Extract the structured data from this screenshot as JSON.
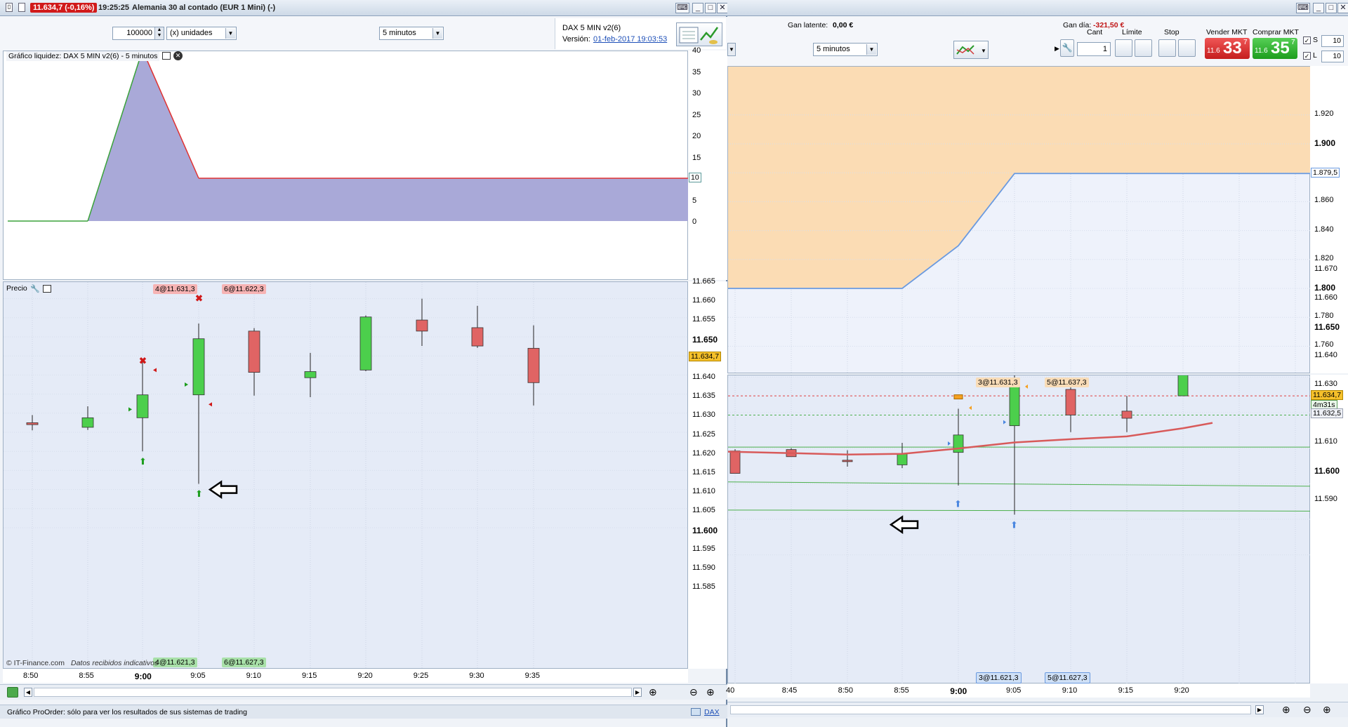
{
  "left_window": {
    "price": "11.634,7 (-0,16%)",
    "time": "19:25:25",
    "instrument": "Alemania 30 al contado (EUR 1 Mini) (-)",
    "quantity_value": "100000",
    "units_select": "(x) unidades",
    "timeframe_select": "5 minutos",
    "strategy_name": "DAX 5 MIN v2(6)",
    "version_label": "Versión:",
    "version_date": "01-feb-2017 19:03:53",
    "equity_panel_title": "Gráfico liquidez: DAX 5 MIN v2(6) - 5 minutos",
    "equity_axis": [
      "40",
      "35",
      "30",
      "25",
      "20",
      "15",
      "10",
      "5",
      "0"
    ],
    "equity_current_marker": "10",
    "price_panel_title": "Precio",
    "price_axis": [
      "11.665",
      "11.660",
      "11.655",
      "11.650",
      "11.645",
      "11.640",
      "11.635",
      "11.630",
      "11.625",
      "11.620",
      "11.615",
      "11.610",
      "11.605",
      "11.600",
      "11.595",
      "11.590",
      "11.585"
    ],
    "price_bold_ticks": [
      "11.650",
      "11.600"
    ],
    "current_price_marker": "11.634,7",
    "order_tags_top": [
      "4@11.631,3",
      "6@11.622,3"
    ],
    "order_tags_bottom": [
      "4@11.621,3",
      "6@11.627,3"
    ],
    "watermark_source": "© IT-Finance.com",
    "watermark_note": "Datos recibidos indicativos",
    "time_axis": [
      "8:50",
      "8:55",
      "9:00",
      "9:05",
      "9:10",
      "9:15",
      "9:20",
      "9:25",
      "9:30",
      "9:35"
    ],
    "status_bar": "Gráfico ProOrder: sólo para ver los resultados de sus sistemas de trading",
    "status_link": "DAX"
  },
  "right_window": {
    "latent_gain_label": "Gan latente:",
    "latent_gain_value": "0,00 €",
    "day_gain_label": "Gan día:",
    "day_gain_value": "-321,50 €",
    "timeframe_select": "5 minutos",
    "qty_label": "Cant",
    "qty_value": "1",
    "limit_label": "Límite",
    "stop_label": "Stop",
    "sell_label": "Vender MKT",
    "sell_small": "11.6",
    "sell_big": "33",
    "sell_sup": "7",
    "buy_label": "Comprar MKT",
    "buy_small": "11.6",
    "buy_big": "35",
    "buy_sup": "7",
    "s_label": "S",
    "s_value": "10",
    "l_label": "L",
    "l_value": "10",
    "upper_axis": [
      "1.920",
      "1.900",
      "1.880",
      "1.860",
      "1.840",
      "1.820",
      "1.800",
      "1.780",
      "1.760"
    ],
    "upper_bold_ticks": [
      "1.900",
      "1.800"
    ],
    "upper_current_marker": "1.879,5",
    "lower_axis": [
      "11.670",
      "11.660",
      "11.650",
      "11.640",
      "11.630",
      "11.620",
      "11.610",
      "11.600",
      "11.590"
    ],
    "lower_bold_ticks": [
      "11.650",
      "11.600"
    ],
    "current_price_marker": "11.634,7",
    "countdown_marker": "4m31s",
    "secondary_marker": "11.632,5",
    "order_tags_top": [
      "3@11.631,3",
      "5@11.637,3"
    ],
    "order_tags_bottom": [
      "3@11.621,3",
      "5@11.627,3"
    ],
    "time_axis": [
      "40",
      "8:45",
      "8:50",
      "8:55",
      "9:00",
      "9:05",
      "9:10",
      "9:15",
      "9:20"
    ]
  },
  "colors": {
    "bull": "#4ccf4c",
    "bear": "#e06464",
    "equity_fill": "#a9a9d8",
    "equity_line_up": "#3aa23a",
    "equity_line_down": "#e03030",
    "chart_bg": "#e5ebf7",
    "orange_band": "#fbdcb4",
    "blue_line": "#6a9ae0"
  }
}
